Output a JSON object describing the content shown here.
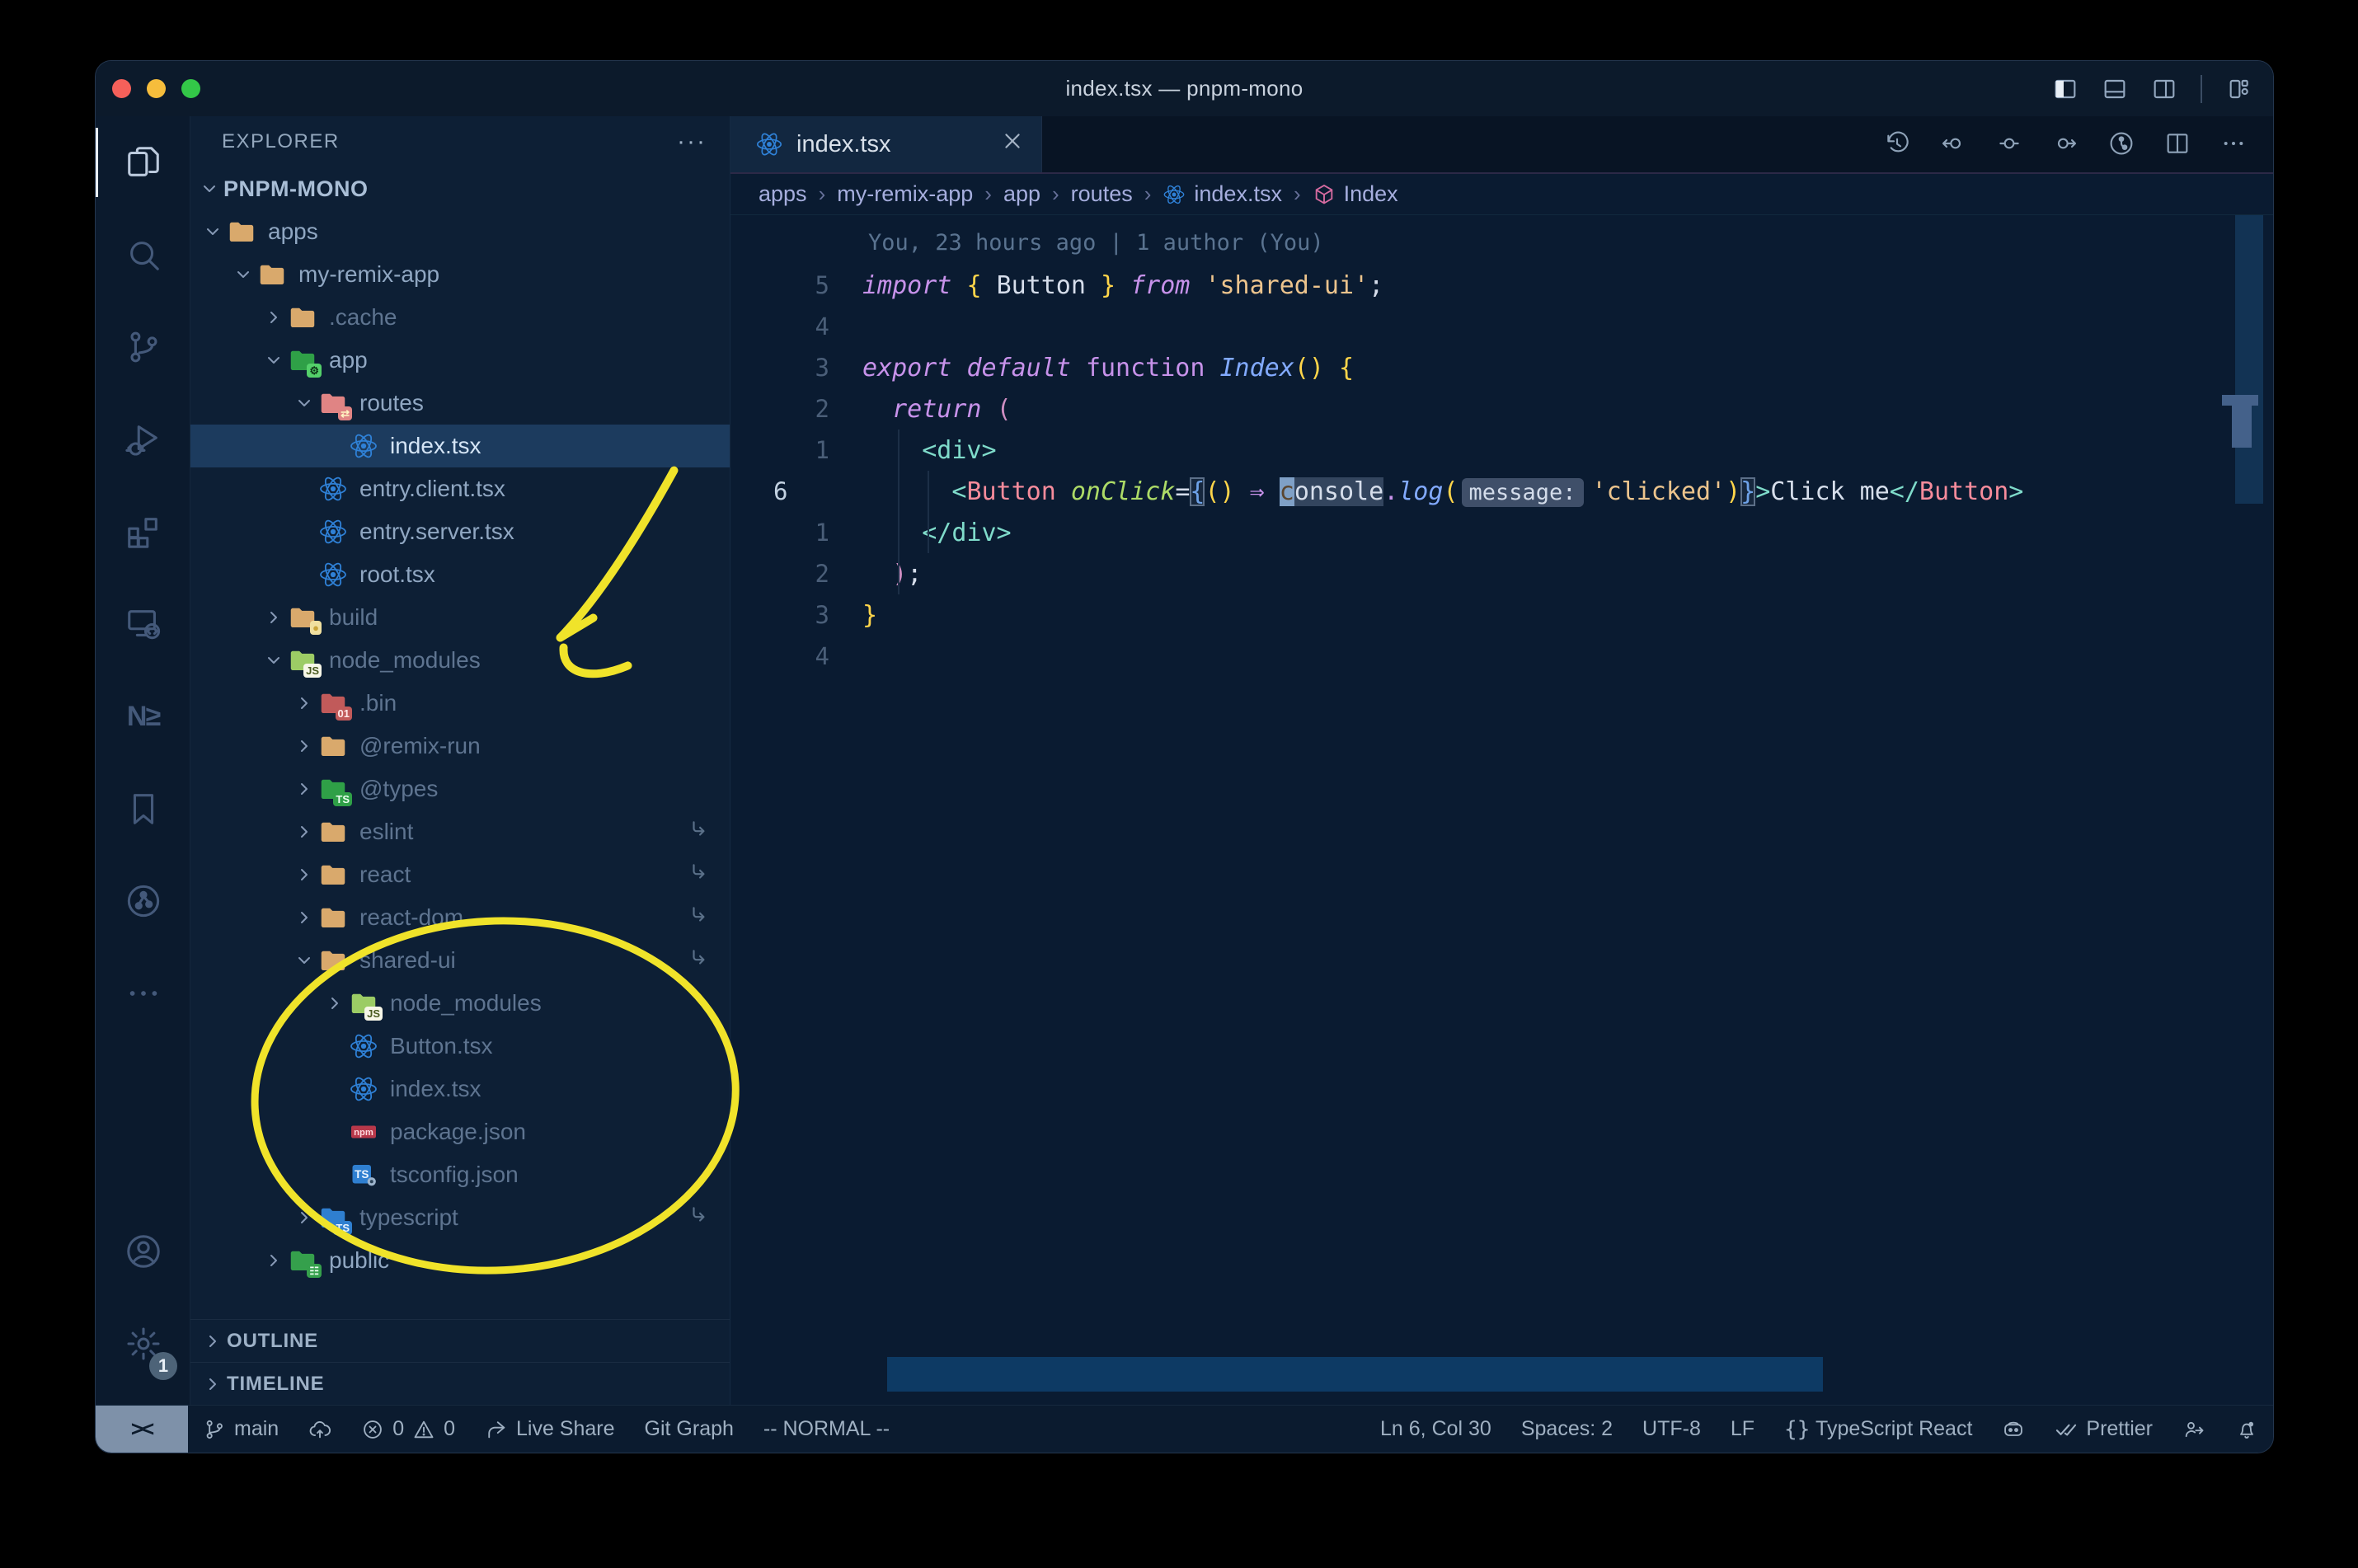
{
  "window": {
    "title": "index.tsx — pnpm-mono"
  },
  "title_bar": {
    "traffic_lights": [
      "close",
      "minimize",
      "zoom"
    ],
    "layout_icons": [
      "toggle-sidebar-icon",
      "toggle-panel-icon",
      "toggle-secondary-sidebar-icon",
      "customize-layout-icon"
    ]
  },
  "activity_bar": {
    "items": [
      {
        "name": "explorer",
        "icon": "files-icon",
        "active": true
      },
      {
        "name": "search",
        "icon": "search-icon"
      },
      {
        "name": "source-control",
        "icon": "source-control-icon"
      },
      {
        "name": "run-debug",
        "icon": "debug-icon"
      },
      {
        "name": "extensions",
        "icon": "extensions-icon"
      },
      {
        "name": "remote-explorer",
        "icon": "remote-explorer-icon"
      },
      {
        "name": "nx-console",
        "icon": "nx-icon",
        "text": "N≥"
      },
      {
        "name": "bookmarks",
        "icon": "bookmark-icon"
      },
      {
        "name": "git-graph",
        "icon": "git-graph-icon"
      },
      {
        "name": "more-views",
        "icon": "ellipsis-icon"
      }
    ],
    "bottom_items": [
      {
        "name": "accounts",
        "icon": "account-icon"
      },
      {
        "name": "settings",
        "icon": "gear-icon",
        "badge": "1"
      }
    ]
  },
  "explorer": {
    "header": "EXPLORER",
    "more": "···",
    "root": "PNPM-MONO",
    "tree": [
      {
        "label": "apps",
        "level": 1,
        "icon": "folder-tan",
        "chevron": "open"
      },
      {
        "label": "my-remix-app",
        "level": 2,
        "icon": "folder-tan",
        "chevron": "open"
      },
      {
        "label": ".cache",
        "level": 3,
        "icon": "folder-tan",
        "chevron": "closed",
        "dim": true
      },
      {
        "label": "app",
        "level": 3,
        "icon": "folder-app",
        "chevron": "open"
      },
      {
        "label": "routes",
        "level": 4,
        "icon": "folder-routes",
        "chevron": "open"
      },
      {
        "label": "index.tsx",
        "level": 5,
        "icon": "react",
        "chevron": "none",
        "selected": true
      },
      {
        "label": "entry.client.tsx",
        "level": 4,
        "icon": "react",
        "chevron": "none"
      },
      {
        "label": "entry.server.tsx",
        "level": 4,
        "icon": "react",
        "chevron": "none"
      },
      {
        "label": "root.tsx",
        "level": 4,
        "icon": "react",
        "chevron": "none"
      },
      {
        "label": "build",
        "level": 3,
        "icon": "folder-build",
        "chevron": "closed",
        "dim": true
      },
      {
        "label": "node_modules",
        "level": 3,
        "icon": "folder-node",
        "chevron": "open",
        "dim": true
      },
      {
        "label": ".bin",
        "level": 4,
        "icon": "folder-bin",
        "chevron": "closed",
        "dim": true
      },
      {
        "label": "@remix-run",
        "level": 4,
        "icon": "folder-tan",
        "chevron": "closed",
        "dim": true
      },
      {
        "label": "@types",
        "level": 4,
        "icon": "folder-types",
        "chevron": "closed",
        "dim": true
      },
      {
        "label": "eslint",
        "level": 4,
        "icon": "folder-tan",
        "chevron": "closed",
        "dim": true,
        "symlink": true
      },
      {
        "label": "react",
        "level": 4,
        "icon": "folder-tan",
        "chevron": "closed",
        "dim": true,
        "symlink": true
      },
      {
        "label": "react-dom",
        "level": 4,
        "icon": "folder-tan",
        "chevron": "closed",
        "dim": true,
        "symlink": true
      },
      {
        "label": "shared-ui",
        "level": 4,
        "icon": "folder-tan",
        "chevron": "open",
        "dim": true,
        "symlink": true
      },
      {
        "label": "node_modules",
        "level": 5,
        "icon": "folder-node",
        "chevron": "closed",
        "dim": true
      },
      {
        "label": "Button.tsx",
        "level": 5,
        "icon": "react",
        "chevron": "none",
        "dim": true
      },
      {
        "label": "index.tsx",
        "level": 5,
        "icon": "react",
        "chevron": "none",
        "dim": true
      },
      {
        "label": "package.json",
        "level": 5,
        "icon": "npm",
        "chevron": "none",
        "dim": true
      },
      {
        "label": "tsconfig.json",
        "level": 5,
        "icon": "tsgear",
        "chevron": "none",
        "dim": true
      },
      {
        "label": "typescript",
        "level": 4,
        "icon": "folder-ts",
        "chevron": "closed",
        "dim": true,
        "symlink": true
      },
      {
        "label": "public",
        "level": 3,
        "icon": "folder-public",
        "chevron": "closed"
      }
    ],
    "sections": [
      "OUTLINE",
      "TIMELINE"
    ]
  },
  "tabs": [
    {
      "label": "index.tsx",
      "icon": "react-icon"
    }
  ],
  "breadcrumbs": [
    {
      "label": "apps"
    },
    {
      "label": "my-remix-app"
    },
    {
      "label": "app"
    },
    {
      "label": "routes"
    },
    {
      "label": "index.tsx",
      "icon": "react-icon"
    },
    {
      "label": "Index",
      "icon": "symbol-module-icon"
    }
  ],
  "editor": {
    "blame": "You, 23 hours ago | 1 author (You)",
    "lines": [
      {
        "num": "5",
        "tokens": [
          {
            "t": "import",
            "c": "kw"
          },
          {
            "t": " ",
            "c": "var"
          },
          {
            "t": "{ ",
            "c": "gold"
          },
          {
            "t": "Button",
            "c": "var"
          },
          {
            "t": " }",
            "c": "gold"
          },
          {
            "t": " ",
            "c": "var"
          },
          {
            "t": "from",
            "c": "kw"
          },
          {
            "t": " ",
            "c": "var"
          },
          {
            "t": "'shared-ui'",
            "c": "str"
          },
          {
            "t": ";",
            "c": "var"
          }
        ]
      },
      {
        "num": "4",
        "tokens": []
      },
      {
        "num": "3",
        "tokens": [
          {
            "t": "export",
            "c": "kw"
          },
          {
            "t": " ",
            "c": "var"
          },
          {
            "t": "default",
            "c": "kw"
          },
          {
            "t": " ",
            "c": "var"
          },
          {
            "t": "function",
            "c": "kw2"
          },
          {
            "t": " ",
            "c": "var"
          },
          {
            "t": "Index",
            "c": "fn"
          },
          {
            "t": "()",
            "c": "gold"
          },
          {
            "t": " ",
            "c": "var"
          },
          {
            "t": "{",
            "c": "gold"
          }
        ]
      },
      {
        "num": "2",
        "tokens": [
          {
            "t": "  ",
            "c": "var"
          },
          {
            "t": "return",
            "c": "kw"
          },
          {
            "t": " ",
            "c": "var"
          },
          {
            "t": "(",
            "c": "pink"
          }
        ]
      },
      {
        "num": "1",
        "tokens": [
          {
            "t": "    ",
            "c": "var"
          },
          {
            "t": "<div>",
            "c": "teal"
          }
        ]
      },
      {
        "num": "6",
        "current": true,
        "tokens": [
          {
            "t": "      ",
            "c": "var"
          },
          {
            "t": "<",
            "c": "teal"
          },
          {
            "t": "Button",
            "c": "comp"
          },
          {
            "t": " ",
            "c": "var"
          },
          {
            "t": "onClick",
            "c": "attr"
          },
          {
            "t": "=",
            "c": "var"
          },
          {
            "t": "{",
            "c": "bm"
          },
          {
            "t": "()",
            "c": "gold"
          },
          {
            "t": " ",
            "c": "var"
          },
          {
            "t": "⇒",
            "c": "op"
          },
          {
            "t": " ",
            "c": "var"
          },
          {
            "t": "c",
            "c": "cursor"
          },
          {
            "t": "onsole",
            "c": "hl"
          },
          {
            "t": ".",
            "c": "op"
          },
          {
            "t": "log",
            "c": "fn"
          },
          {
            "t": "(",
            "c": "gold"
          },
          {
            "t": "message:",
            "c": "inlay"
          },
          {
            "t": "'clicked'",
            "c": "str"
          },
          {
            "t": ")",
            "c": "gold"
          },
          {
            "t": "}",
            "c": "bm"
          },
          {
            "t": ">",
            "c": "teal"
          },
          {
            "t": "Click me",
            "c": "var"
          },
          {
            "t": "</",
            "c": "teal"
          },
          {
            "t": "Button",
            "c": "comp"
          },
          {
            "t": ">",
            "c": "teal"
          }
        ]
      },
      {
        "num": "1",
        "tokens": [
          {
            "t": "    ",
            "c": "var"
          },
          {
            "t": "</div>",
            "c": "teal"
          }
        ]
      },
      {
        "num": "2",
        "tokens": [
          {
            "t": "  ",
            "c": "var"
          },
          {
            "t": ")",
            "c": "pink"
          },
          {
            "t": ";",
            "c": "var"
          }
        ]
      },
      {
        "num": "3",
        "tokens": [
          {
            "t": "}",
            "c": "gold"
          }
        ]
      },
      {
        "num": "4",
        "tokens": []
      }
    ]
  },
  "status_bar": {
    "left": [
      {
        "name": "remote",
        "icon": "remote-icon",
        "label": "><"
      },
      {
        "name": "branch",
        "icon": "branch-icon",
        "label": "main"
      },
      {
        "name": "sync",
        "icon": "cloud-upload-icon",
        "label": ""
      },
      {
        "name": "problems",
        "icon": "error-icon",
        "label": "0",
        "icon2": "warning-icon",
        "label2": "0"
      },
      {
        "name": "live-share",
        "icon": "live-share-icon",
        "label": "Live Share"
      },
      {
        "name": "git-graph",
        "label": "Git Graph"
      },
      {
        "name": "vim-mode",
        "label": "-- NORMAL --"
      }
    ],
    "right": [
      {
        "name": "cursor-position",
        "label": "Ln 6, Col 30"
      },
      {
        "name": "indentation",
        "label": "Spaces: 2"
      },
      {
        "name": "encoding",
        "label": "UTF-8"
      },
      {
        "name": "eol",
        "label": "LF"
      },
      {
        "name": "language-mode",
        "icon": "braces-icon",
        "label": "TypeScript React"
      },
      {
        "name": "copilot",
        "icon": "copilot-icon",
        "label": ""
      },
      {
        "name": "formatter",
        "icon": "double-check-icon",
        "label": "Prettier"
      },
      {
        "name": "feedback",
        "icon": "feedback-icon",
        "label": ""
      },
      {
        "name": "notifications",
        "icon": "bell-icon",
        "label": ""
      }
    ]
  },
  "annotations": {
    "color": "#f0e32a",
    "items": [
      "arrow-to-node-modules",
      "ellipse-around-shared-ui"
    ]
  }
}
